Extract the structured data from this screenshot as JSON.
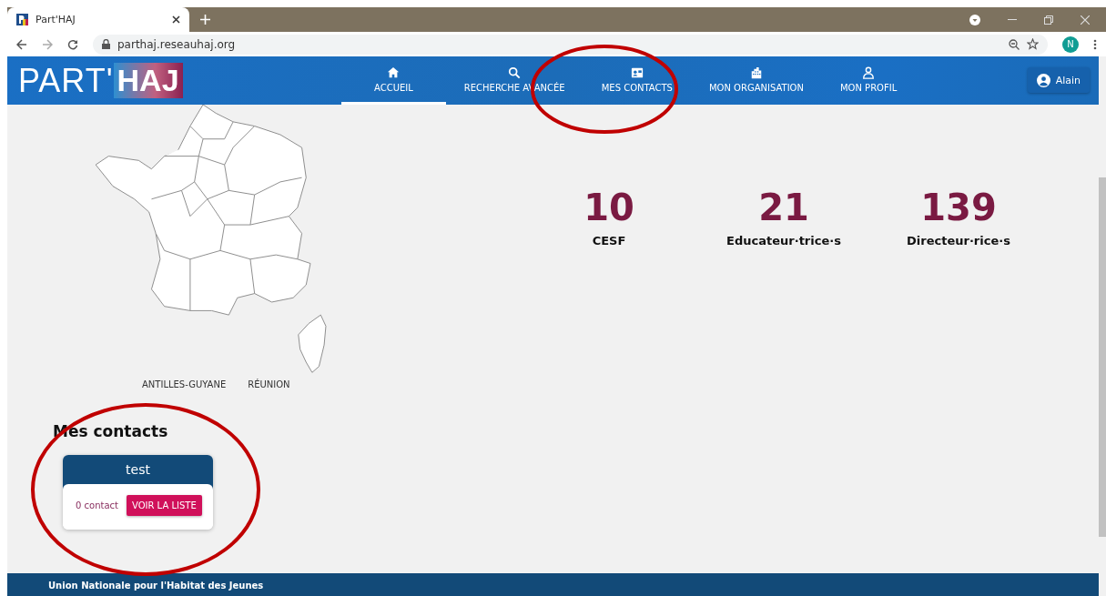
{
  "browser": {
    "tab_title": "Part'HAJ",
    "url": "parthaj.reseauhaj.org",
    "profile_initial": "N"
  },
  "navbar": {
    "logo_left": "PART'",
    "logo_right": "HAJ",
    "items": [
      {
        "label": "ACCUEIL",
        "kind": "home",
        "selected": true
      },
      {
        "label": "RECHERCHE AVANCÉE",
        "kind": "search",
        "selected": false
      },
      {
        "label": "MES CONTACTS",
        "kind": "contact",
        "selected": false
      },
      {
        "label": "MON ORGANISATION",
        "kind": "building",
        "selected": false
      },
      {
        "label": "MON PROFIL",
        "kind": "person",
        "selected": false
      }
    ],
    "user": "Alain"
  },
  "map": {
    "labels": [
      "ANTILLES-GUYANE",
      "RÉUNION"
    ]
  },
  "stats": [
    {
      "value": "10",
      "label": "CESF"
    },
    {
      "value": "21",
      "label": "Educateur·trice·s"
    },
    {
      "value": "139",
      "label": "Directeur·rice·s"
    }
  ],
  "contacts": {
    "title": "Mes contacts",
    "lists": [
      {
        "name": "test",
        "count": "0 contact",
        "button": "VOIR LA LISTE"
      }
    ]
  },
  "footer": {
    "text": "Union Nationale pour l'Habitat des Jeunes"
  }
}
